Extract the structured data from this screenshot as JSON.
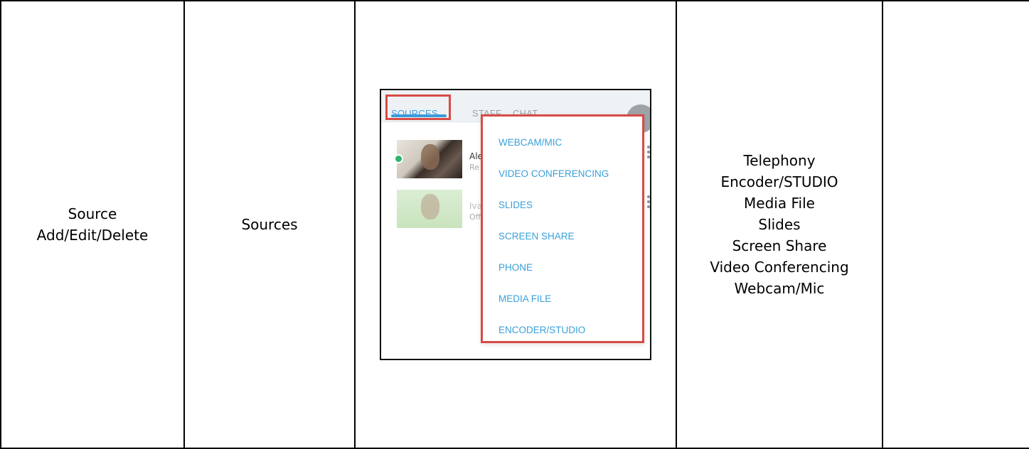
{
  "table": {
    "col1": [
      "Source",
      "Add/Edit/Delete"
    ],
    "col2": "Sources",
    "col4": [
      "Telephony",
      "Encoder/STUDIO",
      "Media File",
      "Slides",
      "Screen Share",
      "Video Conferencing",
      "Webcam/Mic"
    ],
    "col5": ""
  },
  "screenshot": {
    "tabs": [
      "SOURCES",
      "STAFF",
      "CHAT"
    ],
    "active_tab": "SOURCES",
    "sources": [
      {
        "name": "Ale",
        "status": "Re"
      },
      {
        "name": "Iva",
        "status": "Off"
      }
    ],
    "close_icon": "×",
    "menu_items": [
      "WEBCAM/MIC",
      "VIDEO CONFERENCING",
      "SLIDES",
      "SCREEN SHARE",
      "PHONE",
      "MEDIA FILE",
      "ENCODER/STUDIO"
    ],
    "colors": {
      "accent": "#3aa0d8",
      "highlight": "#d84a45",
      "online": "#2db36a"
    }
  }
}
